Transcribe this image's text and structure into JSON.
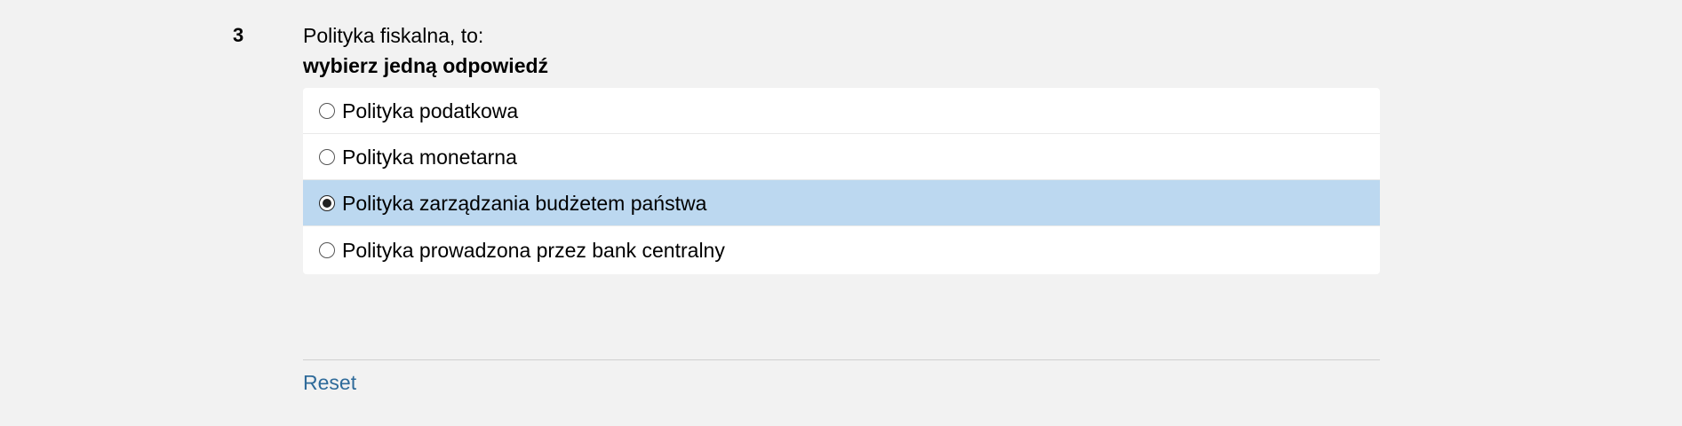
{
  "question": {
    "number": "3",
    "text": "Polityka fiskalna, to:",
    "instruction": "wybierz jedną odpowiedź",
    "options": [
      {
        "label": "Polityka podatkowa",
        "selected": false
      },
      {
        "label": "Polityka monetarna",
        "selected": false
      },
      {
        "label": "Polityka zarządzania budżetem państwa",
        "selected": true
      },
      {
        "label": "Polityka prowadzona przez bank centralny",
        "selected": false
      }
    ],
    "reset_label": "Reset"
  },
  "colors": {
    "background": "#f2f2f2",
    "selected_highlight": "#bcd8f0",
    "link": "#2f6b9a"
  }
}
